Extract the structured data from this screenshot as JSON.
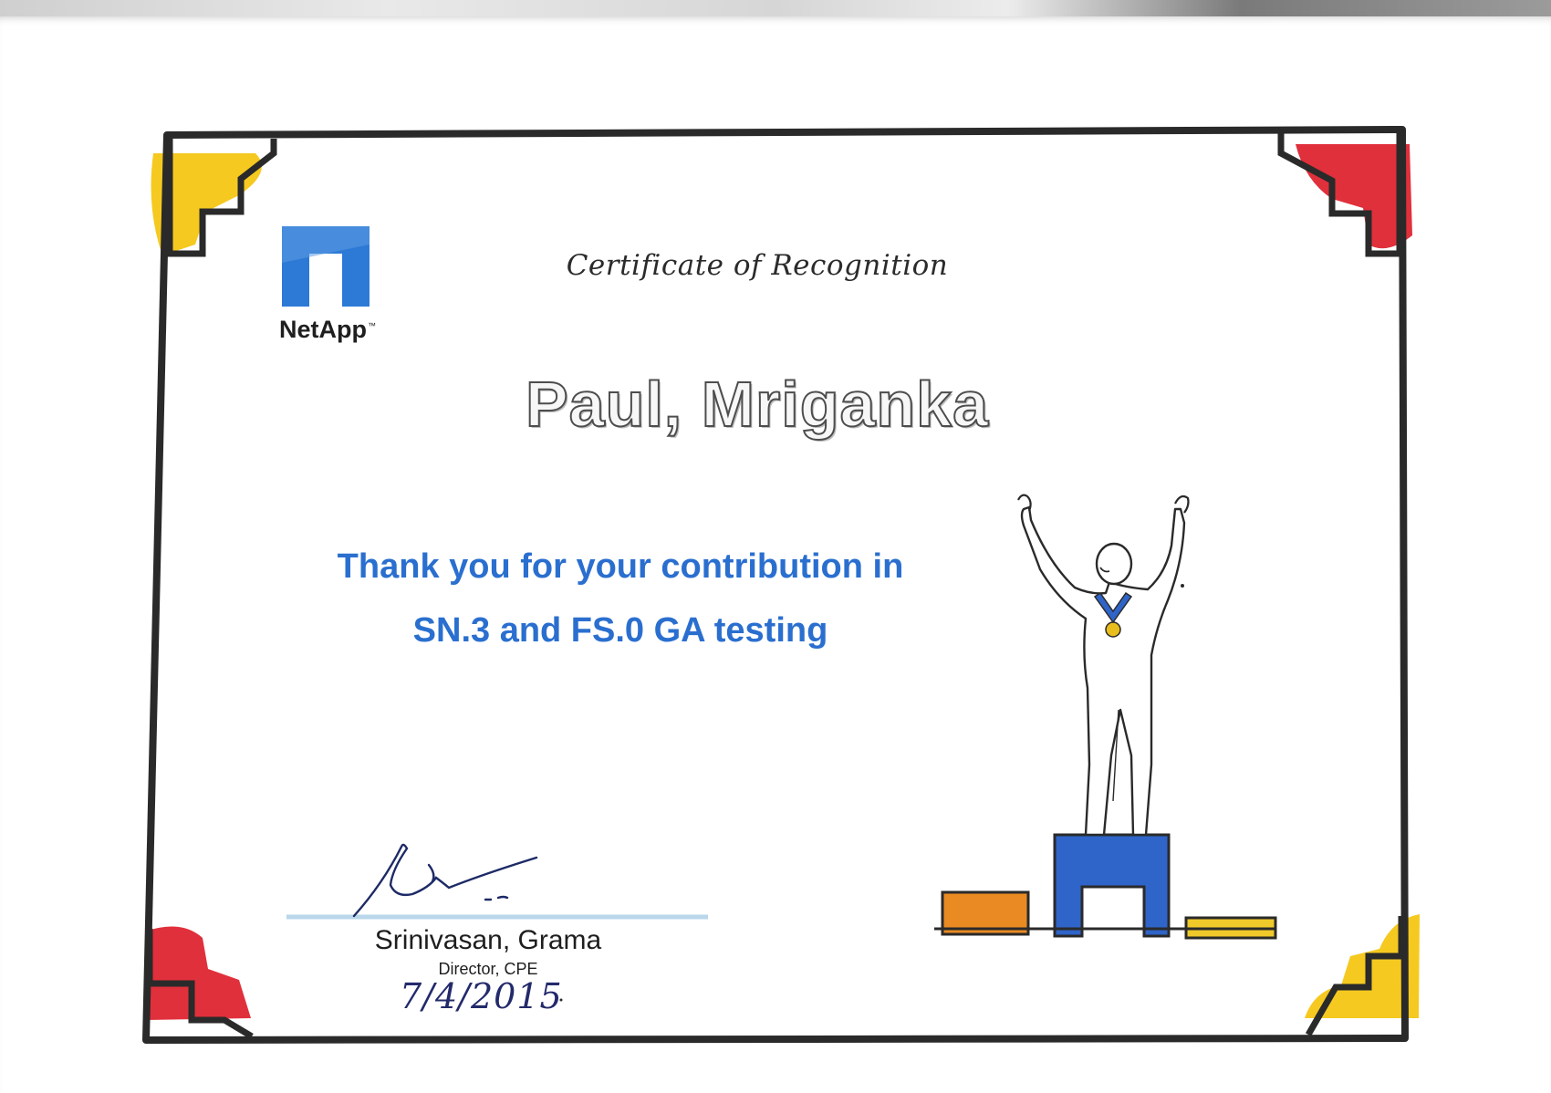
{
  "certificate": {
    "title": "Certificate of Recognition",
    "recipient": "Paul, Mriganka",
    "message_line_1": "Thank you for your contribution in",
    "message_line_2": "SN.3 and FS.0 GA testing"
  },
  "logo": {
    "name": "NetApp",
    "icon": "netapp-n-logo-icon",
    "color": "#2d7ad6"
  },
  "signatory": {
    "name": "Srinivasan, Grama",
    "title": "Director, CPE",
    "handwritten_date": "7/4/2015"
  },
  "illustration": {
    "icon": "winner-on-podium-icon"
  },
  "colors": {
    "frame": "#2a2a2a",
    "corner_yellow": "#f5c920",
    "corner_red": "#e0303b",
    "podium_blue": "#2f64c8",
    "podium_orange": "#e98a22",
    "podium_yellow": "#f0c92a",
    "medal_ribbon": "#2f64c8",
    "medal_gold": "#e8bd1c",
    "message_blue": "#2a6fcf"
  }
}
